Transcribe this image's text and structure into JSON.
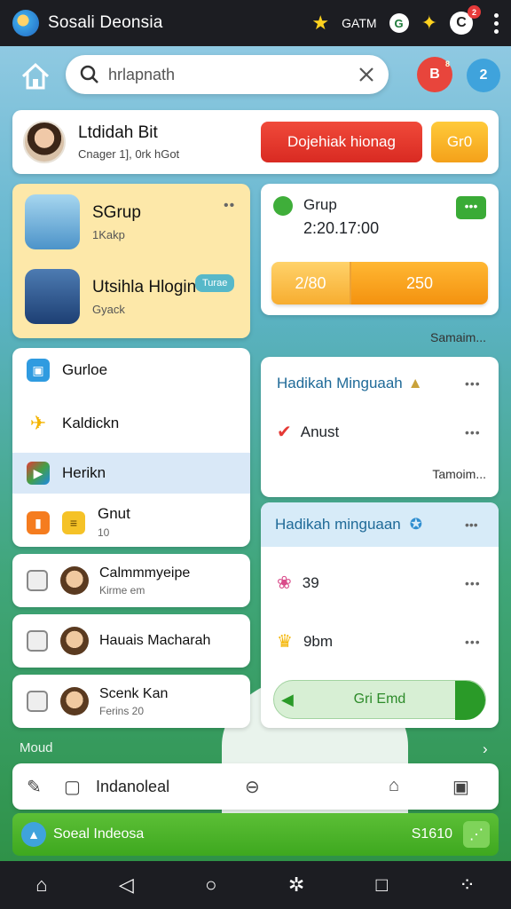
{
  "status_bar": {
    "app_title": "Sosali Deonsia",
    "label": "GATM",
    "g_label": "G",
    "c_label": "C",
    "badge": "2"
  },
  "header": {
    "search_value": "hrlapnath",
    "red_button_label": "B",
    "red_badge": "8",
    "blue_button_label": "2"
  },
  "profile": {
    "name": "Ltdidah Bit",
    "sub": "Cnager  1], 0rk hGot",
    "primary_button": "Dojehiak hionag",
    "secondary_button": "Gr0"
  },
  "groups": [
    {
      "title": "SGrup",
      "sub": "1Kakp"
    },
    {
      "title": "Utsihla Hlogin",
      "sub": "Gyack",
      "badge": "Turae"
    }
  ],
  "menu": [
    {
      "label": "Gurloe"
    },
    {
      "label": "Kaldickn"
    },
    {
      "label": "Herikn"
    },
    {
      "label": "Gnut",
      "sub": "10"
    }
  ],
  "list_cards": [
    {
      "title": "Calmmmyeipe",
      "sub": "Kirme em"
    },
    {
      "title": "Hauais Macharah",
      "sub": ""
    },
    {
      "title": "Scenk Kan",
      "sub": "Ferins 20"
    }
  ],
  "grup_card": {
    "title": "Grup",
    "time": "2:20.17:00",
    "left_value": "2/80",
    "right_value": "250"
  },
  "samaim_text": "Samaim...",
  "weekly1": {
    "title": "Hadikah Minguaah",
    "item": "Anust",
    "footer": "Tamoim..."
  },
  "weekly2": {
    "title": "Hadikah minguaan",
    "items": [
      {
        "label": "39"
      },
      {
        "label": "9bm"
      }
    ],
    "cta": "Gri Emd"
  },
  "section": {
    "label": "Moud"
  },
  "tabs": {
    "label": "Indanoleal"
  },
  "bottom_bar": {
    "label": "Soeal Indeosa",
    "value": "S1610"
  },
  "colors": {
    "accent_red": "#e0332a",
    "accent_orange": "#f4a11a",
    "accent_green": "#3aab36",
    "accent_blue": "#3fa3dc"
  }
}
